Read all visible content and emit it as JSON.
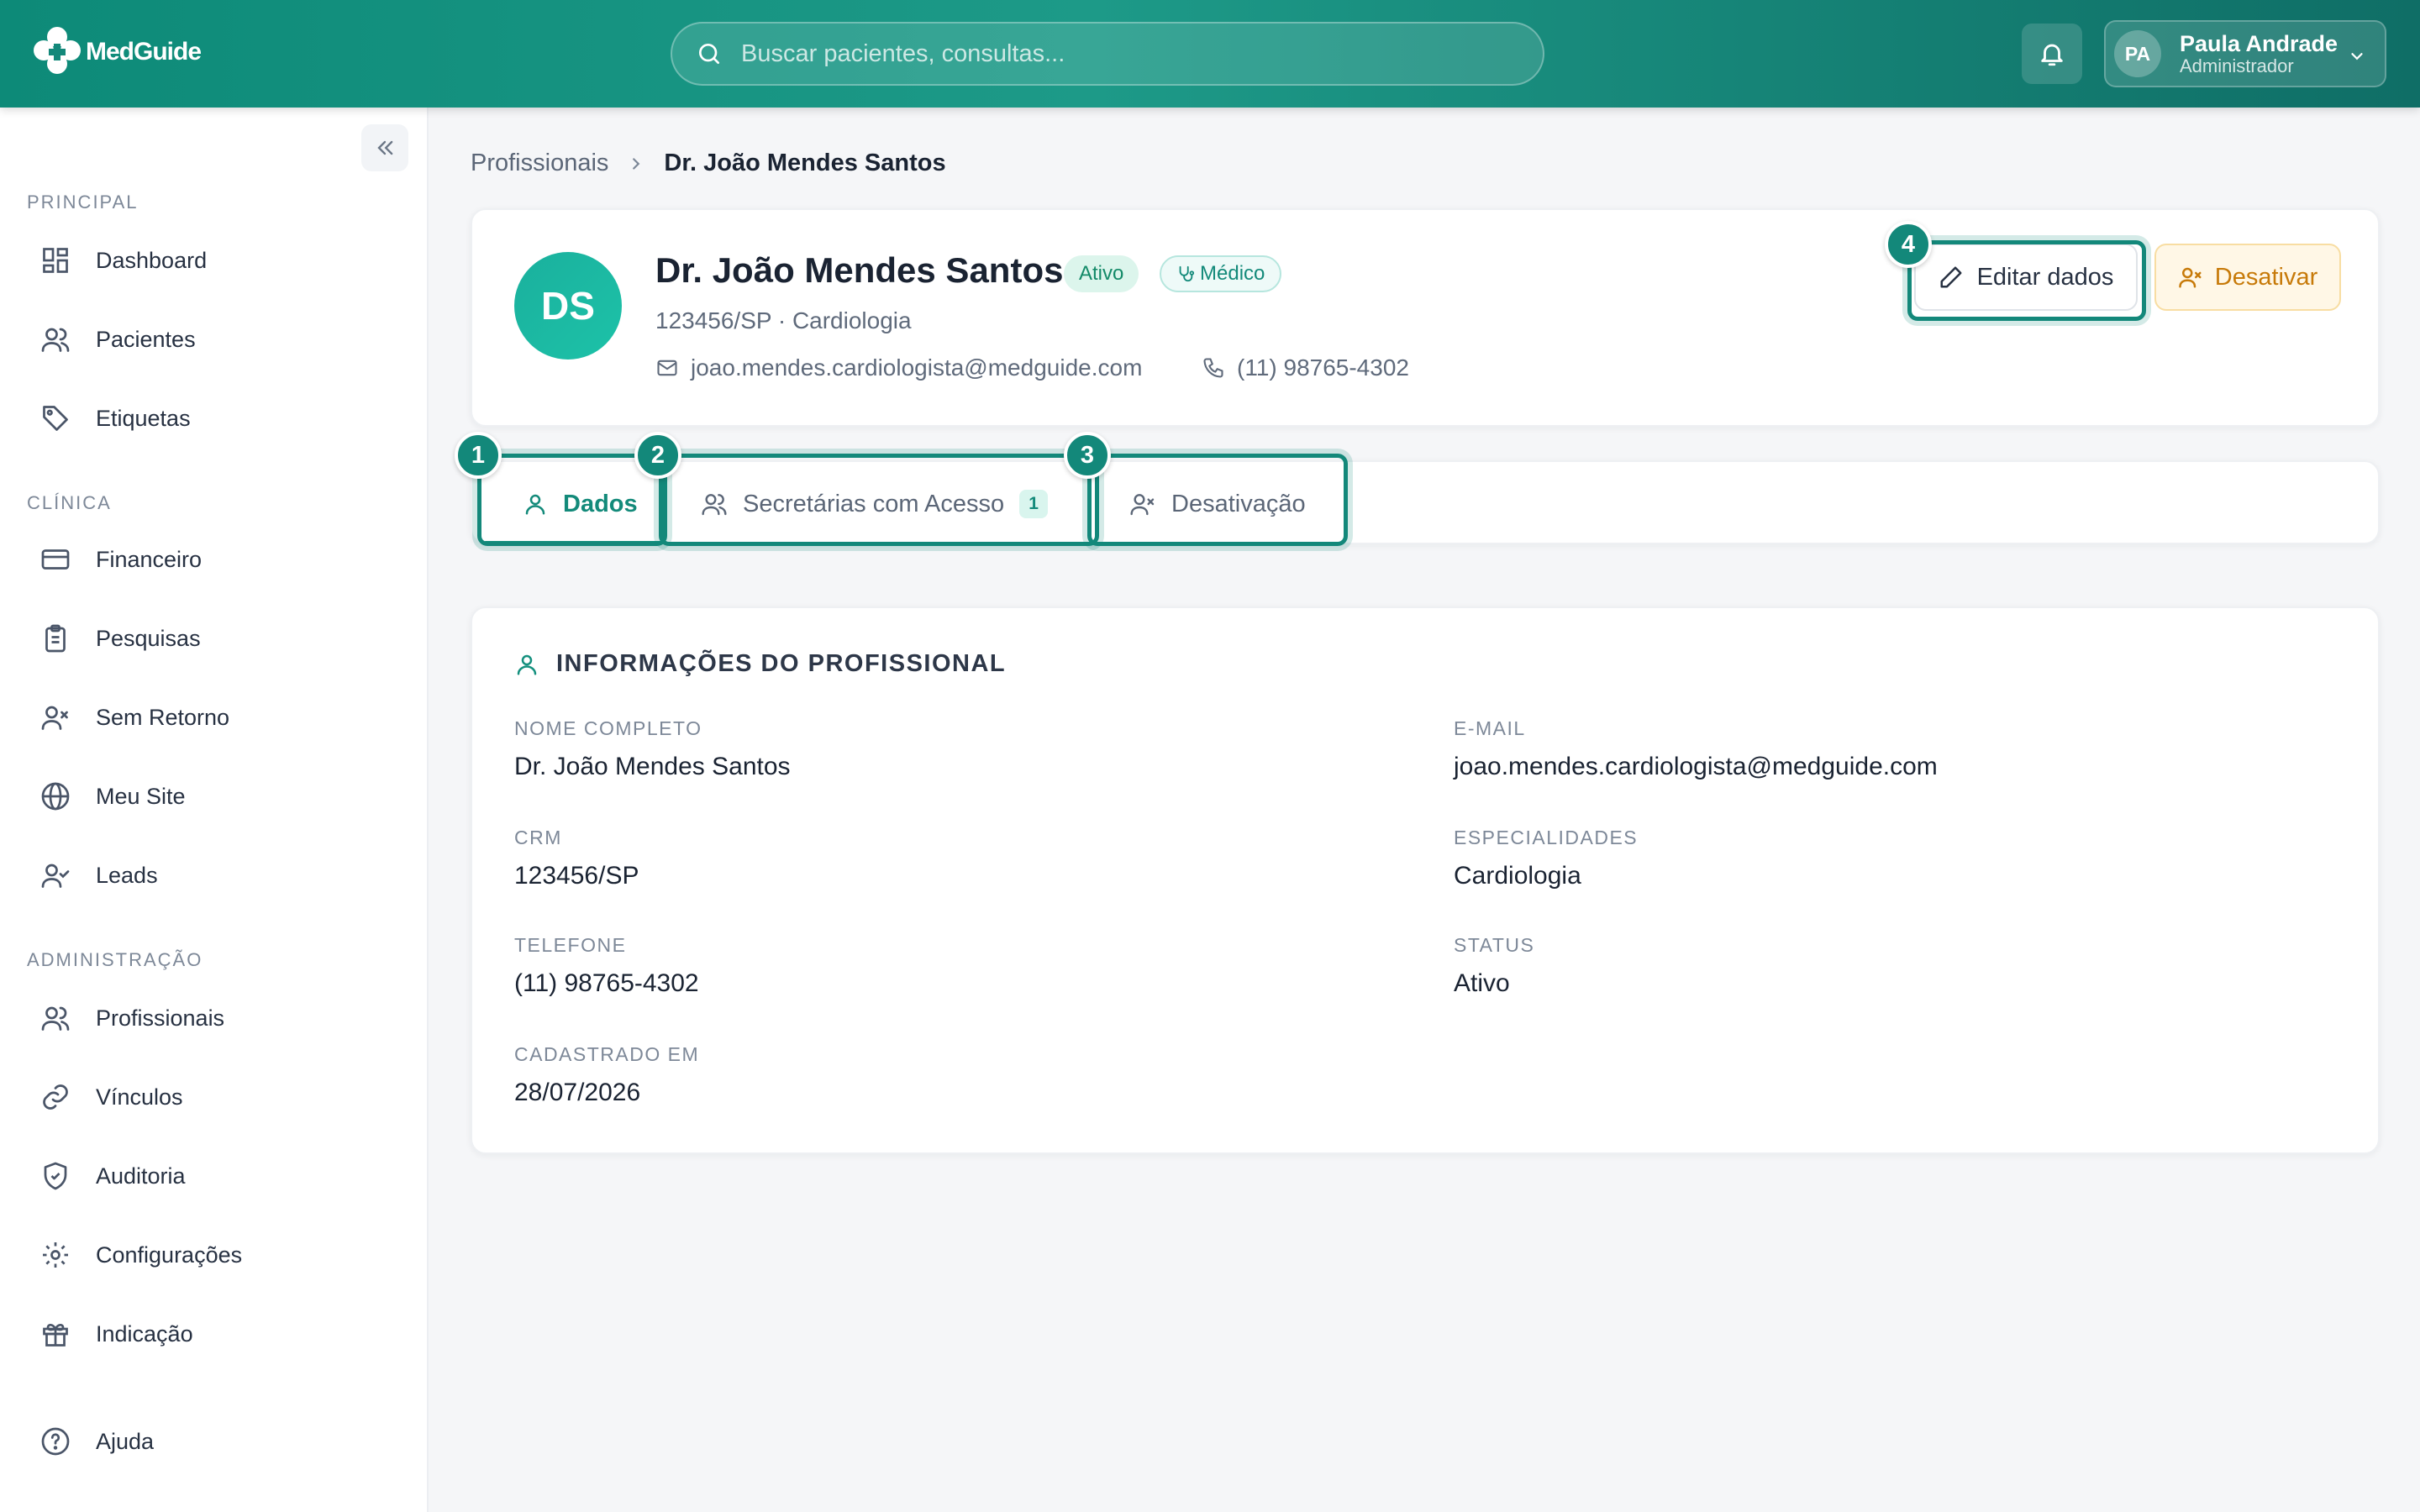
{
  "topbar": {
    "app_name": "MedGuide",
    "search_placeholder": "Buscar pacientes, consultas...",
    "user": {
      "initials": "PA",
      "name": "Paula Andrade",
      "role": "Administrador"
    }
  },
  "sidebar": {
    "sections": [
      {
        "label": "PRINCIPAL",
        "items": [
          {
            "label": "Dashboard",
            "icon": "dashboard-icon"
          },
          {
            "label": "Pacientes",
            "icon": "users-icon"
          },
          {
            "label": "Etiquetas",
            "icon": "tag-icon"
          }
        ]
      },
      {
        "label": "CLÍNICA",
        "items": [
          {
            "label": "Financeiro",
            "icon": "credit-card-icon"
          },
          {
            "label": "Pesquisas",
            "icon": "clipboard-icon"
          },
          {
            "label": "Sem Retorno",
            "icon": "user-x-icon"
          },
          {
            "label": "Meu Site",
            "icon": "globe-icon"
          },
          {
            "label": "Leads",
            "icon": "user-check-icon"
          }
        ]
      },
      {
        "label": "ADMINISTRAÇÃO",
        "items": [
          {
            "label": "Profissionais",
            "icon": "users-icon"
          },
          {
            "label": "Vínculos",
            "icon": "link-icon"
          },
          {
            "label": "Auditoria",
            "icon": "shield-icon"
          },
          {
            "label": "Configurações",
            "icon": "gear-icon"
          },
          {
            "label": "Indicação",
            "icon": "gift-icon"
          }
        ]
      }
    ],
    "footer_item": {
      "label": "Ajuda",
      "icon": "help-icon"
    }
  },
  "breadcrumb": {
    "parent": "Profissionais",
    "current": "Dr. João Mendes Santos"
  },
  "profile": {
    "initials": "DS",
    "name": "Dr. João Mendes Santos",
    "status_badge": "Ativo",
    "role_badge": "Médico",
    "subtitle": "123456/SP · Cardiologia",
    "email": "joao.mendes.cardiologista@medguide.com",
    "phone": "(11) 98765-4302",
    "edit_label": "Editar dados",
    "deactivate_label": "Desativar"
  },
  "tabs": [
    {
      "label": "Dados",
      "active": true
    },
    {
      "label": "Secretárias com Acesso",
      "count": "1"
    },
    {
      "label": "Desativação"
    }
  ],
  "markers": [
    "1",
    "2",
    "3",
    "4"
  ],
  "info": {
    "title": "INFORMAÇÕES DO PROFISSIONAL",
    "fields": [
      {
        "label": "NOME COMPLETO",
        "value": "Dr. João Mendes Santos"
      },
      {
        "label": "E-MAIL",
        "value": "joao.mendes.cardiologista@medguide.com"
      },
      {
        "label": "CRM",
        "value": "123456/SP"
      },
      {
        "label": "ESPECIALIDADES",
        "value": "Cardiologia"
      },
      {
        "label": "TELEFONE",
        "value": "(11) 98765-4302"
      },
      {
        "label": "STATUS",
        "value": "Ativo"
      },
      {
        "label": "CADASTRADO EM",
        "value": "28/07/2026"
      }
    ]
  },
  "colors": {
    "brand": "#13887a",
    "warning": "#c77a09",
    "success": "#138a68"
  }
}
